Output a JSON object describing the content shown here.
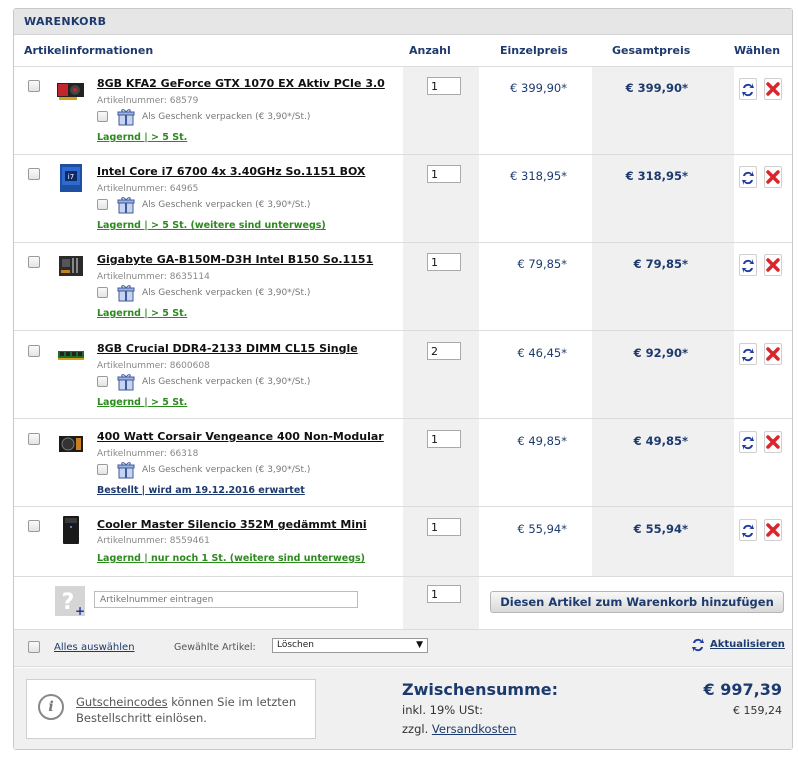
{
  "header": {
    "title": "WARENKORB"
  },
  "columns": {
    "info": "Artikelinformationen",
    "qty": "Anzahl",
    "unit": "Einzelpreis",
    "total": "Gesamtpreis",
    "select": "Wählen"
  },
  "gift_label": "Als Geschenk verpacken (€ 3,90*/St.)",
  "items": [
    {
      "name": "8GB KFA2 GeForce GTX 1070 EX Aktiv PCIe 3.0",
      "sku": "Artikelnummer: 68579",
      "stock": "Lagernd | > 5 St.",
      "qty": "1",
      "unit_price": "€ 399,90*",
      "total_price": "€ 399,90*",
      "thumb": "gpu-icon"
    },
    {
      "name": "Intel Core i7 6700 4x 3.40GHz So.1151 BOX",
      "sku": "Artikelnummer: 64965",
      "stock": "Lagernd | > 5 St. (weitere sind unterwegs)",
      "qty": "1",
      "unit_price": "€ 318,95*",
      "total_price": "€ 318,95*",
      "thumb": "cpu-box-icon"
    },
    {
      "name": "Gigabyte GA-B150M-D3H Intel B150 So.1151",
      "sku": "Artikelnummer: 8635114",
      "stock": "Lagernd | > 5 St.",
      "qty": "1",
      "unit_price": "€ 79,85*",
      "total_price": "€ 79,85*",
      "thumb": "mainboard-icon"
    },
    {
      "name": "8GB Crucial DDR4-2133 DIMM CL15 Single",
      "sku": "Artikelnummer: 8600608",
      "stock": "Lagernd | > 5 St.",
      "qty": "2",
      "unit_price": "€ 46,45*",
      "total_price": "€ 92,90*",
      "thumb": "ram-icon"
    },
    {
      "name": "400 Watt Corsair Vengeance 400 Non-Modular",
      "sku": "Artikelnummer: 66318",
      "stock": "Bestellt | wird am 19.12.2016 erwartet",
      "qty": "1",
      "unit_price": "€ 49,85*",
      "total_price": "€ 49,85*",
      "thumb": "psu-icon"
    },
    {
      "name": "Cooler Master Silencio 352M gedämmt Mini",
      "sku": "Artikelnummer: 8559461",
      "stock": "Lagernd | nur noch 1 St. (weitere sind unterwegs)",
      "qty": "1",
      "unit_price": "€ 55,94*",
      "total_price": "€ 55,94*",
      "thumb": "case-icon"
    }
  ],
  "add_row": {
    "sku_placeholder": "Artikelnummer eintragen",
    "qty": "1",
    "button": "Diesen Artikel zum Warenkorb hinzufügen"
  },
  "bulk": {
    "select_all": "Alles auswählen",
    "selected_label": "Gewählte Artikel:",
    "action_selected": "Löschen",
    "refresh": "Aktualisieren"
  },
  "coupon": {
    "link": "Gutscheincodes",
    "text": " können Sie im letzten Bestellschritt einlösen."
  },
  "summary": {
    "subtotal_label": "Zwischensumme:",
    "subtotal": "€ 997,39",
    "vat_label": "inkl. 19% USt:",
    "vat": "€ 159,24",
    "shipping_prefix": "zzgl. ",
    "shipping_link": "Versandkosten"
  },
  "colors": {
    "accent": "#1d3a6e",
    "in_stock": "#2c8a1e",
    "delete": "#d9262c"
  }
}
